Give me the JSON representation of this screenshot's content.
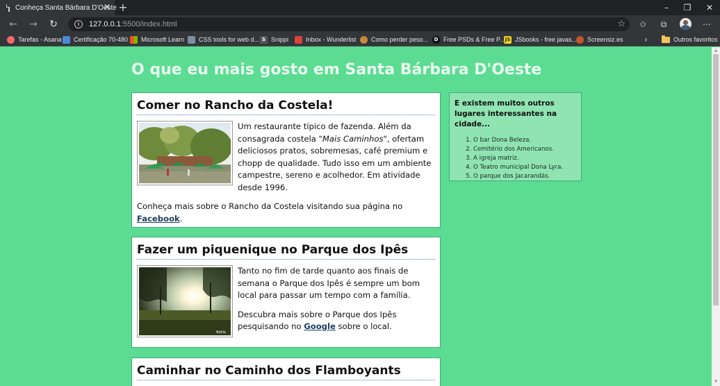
{
  "browser": {
    "tab_title": "Conheça Santa Bárbara D'Oeste",
    "tab_close": "✕",
    "new_tab": "+",
    "url_host": "127.0.0.1",
    "url_path": ":5500/index.html",
    "bookmarks": [
      {
        "label": "Tarefas - Asana",
        "icon": "asana-icon",
        "color": "#f06a6a"
      },
      {
        "label": "Certificação 70-480",
        "icon": "cert-icon",
        "color": "#4a8cd6"
      },
      {
        "label": "Microsoft Learn",
        "icon": "microsoft-icon",
        "color": "#f25022"
      },
      {
        "label": "CSS tools for web d...",
        "icon": "css-tools-icon",
        "color": "#7d8ea0"
      },
      {
        "label": "Snippi",
        "icon": "snippi-icon",
        "color": "#555555"
      },
      {
        "label": "Inbox - Wunderlist",
        "icon": "wunderlist-icon",
        "color": "#d6463c"
      },
      {
        "label": "Como perder peso...",
        "icon": "health-icon",
        "color": "#c58a3d"
      },
      {
        "label": "Free PSDs & Free P...",
        "icon": "psd-icon",
        "color": "#111111"
      },
      {
        "label": "JSbooks - free javas...",
        "icon": "jsbooks-icon",
        "color": "#f0d51e"
      },
      {
        "label": "Screensiz.es",
        "icon": "screensizes-icon",
        "color": "#c2552b"
      }
    ],
    "other_bookmarks": "Outros favoritos"
  },
  "page": {
    "title": "O que eu mais gosto em Santa Bárbara D'Oeste",
    "cards": [
      {
        "heading": "Comer no Rancho da Costela!",
        "text_before_em": "Um restaurante típico de fazenda. Além da consagrada costela ",
        "text_em": "\"Mais Caminhos\"",
        "text_after_em": ", ofertam deliciosos pratos, sobremesas, café premium e chopp de qualidade. Tudo isso em um ambiente campestre, sereno e acolhedor. Em atividade desde 1996.",
        "more_before": "Conheça mais sobre o Rancho da Costela visitando sua página no ",
        "more_link": "Facebook",
        "more_after": "."
      },
      {
        "heading": "Fazer um piquenique no Parque dos Ipês",
        "text": "Tanto no fim de tarde quanto aos finais de semana o Parque dos Ipês é sempre um bom local para passar um tempo com a família.",
        "more_before": "Descubra mais sobre o Parque dos Ipês pesquisando no ",
        "more_link": "Google",
        "more_after": " sobre o local."
      },
      {
        "heading": "Caminhar no Caminho dos Flamboyants"
      }
    ],
    "aside": {
      "heading": "E existem muitos outros lugares interessantes na cidade...",
      "items": [
        "O bar Dona Beleza.",
        "Cemitério dos Americanos.",
        "A igreja matriz.",
        "O Teatro municipal Dona Lyra.",
        "O parque dos Jacarandás."
      ]
    }
  }
}
